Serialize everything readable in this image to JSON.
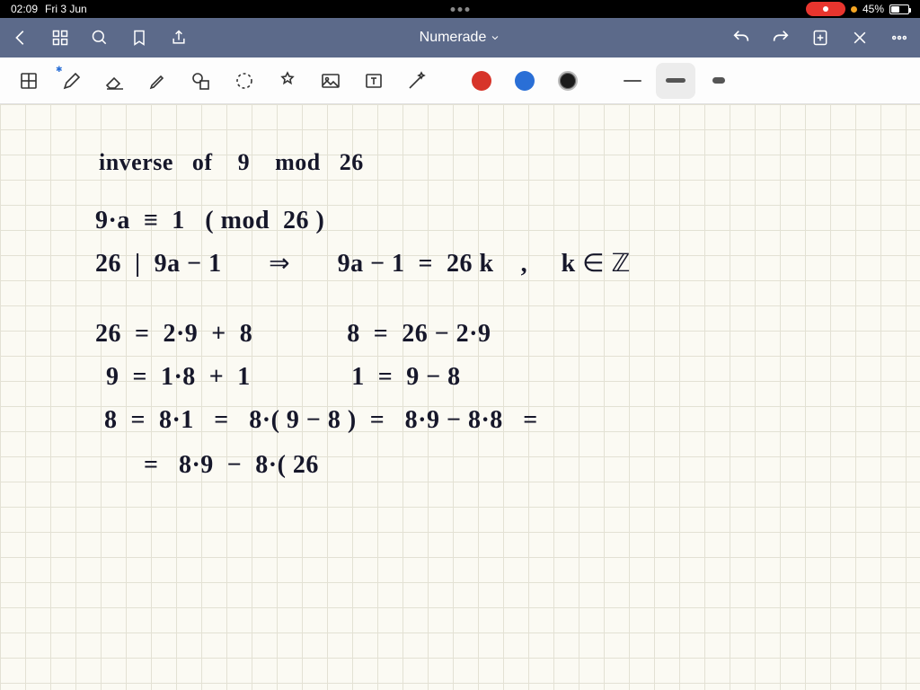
{
  "status_bar": {
    "time": "02:09",
    "date": "Fri 3 Jun",
    "battery_pct": "45%"
  },
  "nav": {
    "title": "Numerade"
  },
  "toolbar": {
    "tools": [
      "notebook",
      "pen",
      "eraser",
      "highlighter",
      "shapes",
      "lasso",
      "stamp",
      "image",
      "text",
      "magic"
    ],
    "colors": [
      "red",
      "blue",
      "black"
    ],
    "selected_color": "black",
    "strokes": [
      "thin",
      "medium",
      "thick"
    ],
    "selected_stroke": "medium"
  },
  "notes": {
    "line1": "inverse   of    9    mod   26",
    "line2": "9·a  ≡  1   ( mod  26 )",
    "line3": "26  |  9a − 1       ⇒       9a − 1  =  26 k    ,     k ∈ ℤ",
    "line4": "26  =  2·9  +  8              8  =  26 − 2·9",
    "line5": "9  =  1·8  +  1               1  =  9 − 8",
    "line6": "8  =  8·1   =   8·( 9 − 8 )  =   8·9 − 8·8   =",
    "line7": "=   8·9  −  8·( 26"
  }
}
